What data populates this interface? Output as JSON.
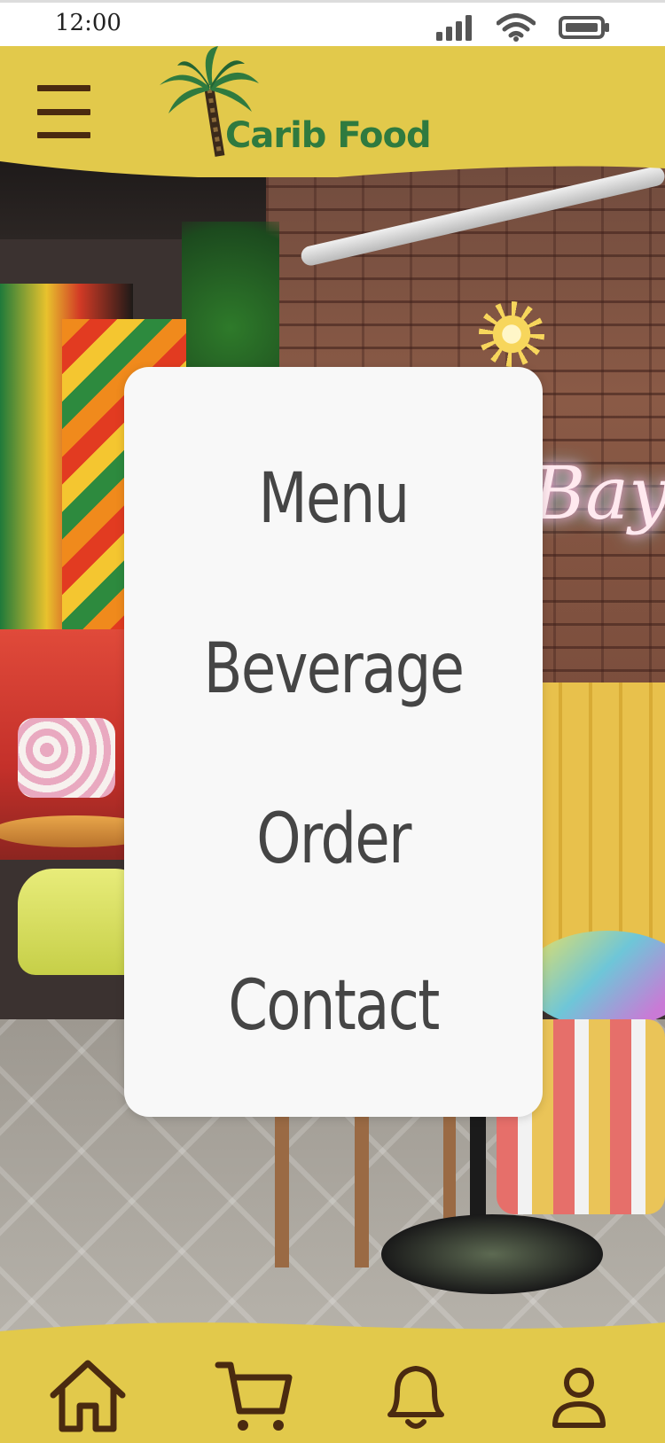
{
  "status_bar": {
    "time": "12:00",
    "icons": [
      "signal-icon",
      "wifi-icon",
      "battery-icon"
    ]
  },
  "header": {
    "menu_icon": "hamburger-menu-icon",
    "logo_text": "Carib Food",
    "logo_icon": "palm-tree-icon"
  },
  "menu": {
    "items": [
      {
        "label": "Menu"
      },
      {
        "label": "Beverage"
      },
      {
        "label": "Order"
      },
      {
        "label": "Contact"
      }
    ]
  },
  "background": {
    "sign_text": "Bay"
  },
  "bottom_nav": {
    "items": [
      {
        "icon": "home-icon"
      },
      {
        "icon": "cart-icon"
      },
      {
        "icon": "bell-icon"
      },
      {
        "icon": "user-icon"
      }
    ]
  },
  "colors": {
    "brand_yellow": "#e2c94b",
    "icon_brown": "#4a2a10",
    "logo_green": "#2f7a3f",
    "card_bg": "#f8f8f8",
    "menu_text": "#454545"
  }
}
